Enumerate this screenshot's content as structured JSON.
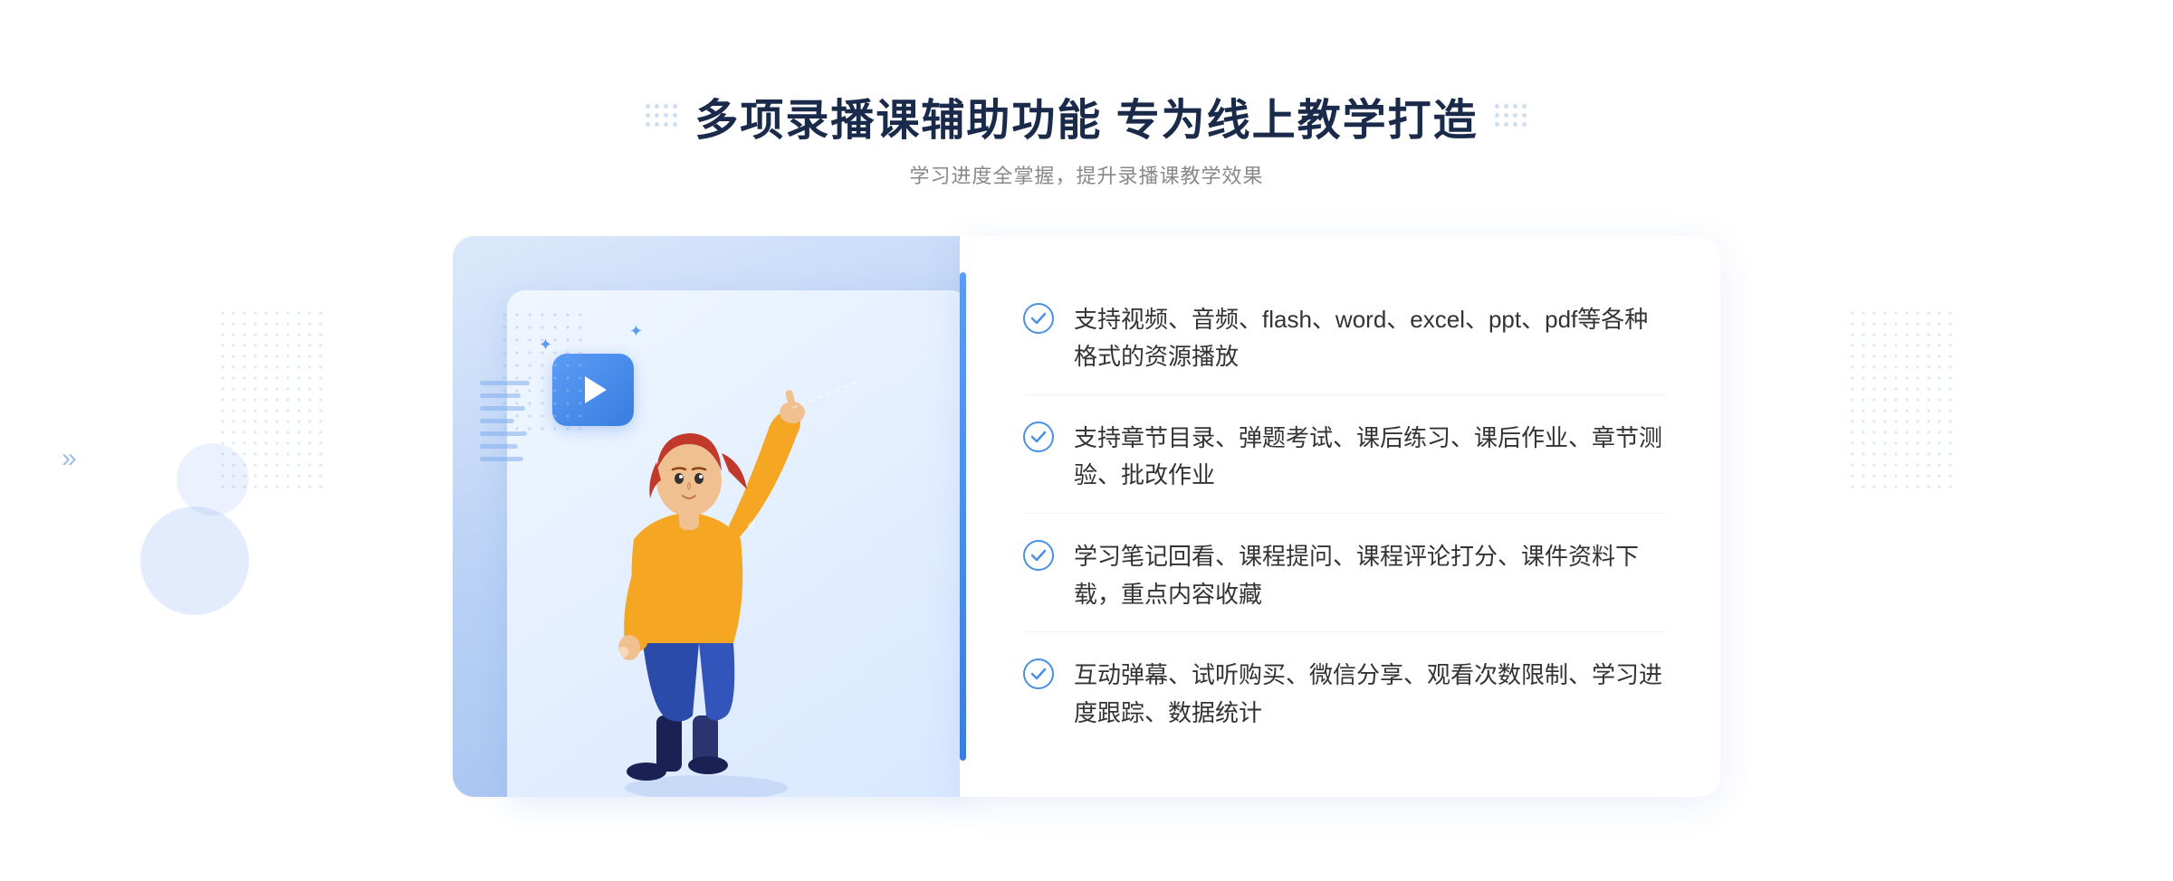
{
  "header": {
    "title": "多项录播课辅助功能 专为线上教学打造",
    "subtitle": "学习进度全掌握，提升录播课教学效果",
    "deco_dots_count": 12
  },
  "features": [
    {
      "id": 1,
      "text": "支持视频、音频、flash、word、excel、ppt、pdf等各种格式的资源播放"
    },
    {
      "id": 2,
      "text": "支持章节目录、弹题考试、课后练习、课后作业、章节测验、批改作业"
    },
    {
      "id": 3,
      "text": "学习笔记回看、课程提问、课程评论打分、课件资料下载，重点内容收藏"
    },
    {
      "id": 4,
      "text": "互动弹幕、试听购买、微信分享、观看次数限制、学习进度跟踪、数据统计"
    }
  ],
  "illustration": {
    "play_icon": "▶",
    "sparkle": "✦"
  },
  "colors": {
    "primary": "#3a7de0",
    "accent": "#5a9cf5",
    "text_dark": "#1a2a4a",
    "text_mid": "#888888",
    "text_body": "#333333"
  }
}
